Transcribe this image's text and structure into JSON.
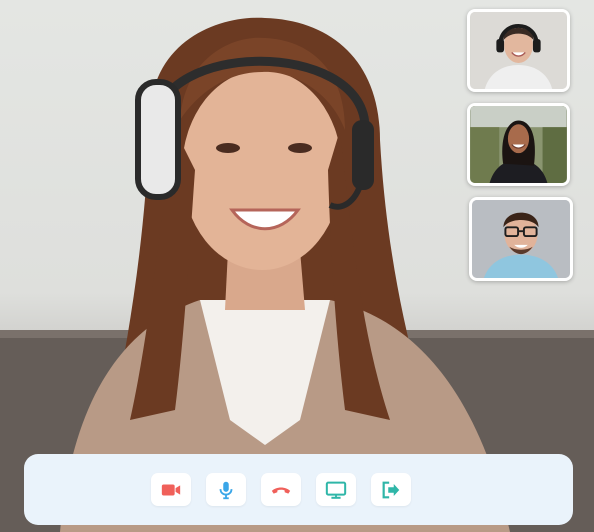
{
  "call": {
    "main_participant": {
      "description_icon": "person-headset-video"
    },
    "thumbnails": [
      {
        "icon": "participant-video",
        "accent": "#d9d7d2"
      },
      {
        "icon": "participant-video",
        "accent": "#7d8a6a"
      },
      {
        "icon": "participant-video",
        "accent": "#b9bdc2"
      }
    ]
  },
  "controls": [
    {
      "icon": "video-camera-icon",
      "color": "#f0605a"
    },
    {
      "icon": "microphone-icon",
      "color": "#3aa6e8"
    },
    {
      "icon": "hang-up-icon",
      "color": "#f0605a"
    },
    {
      "icon": "screen-share-icon",
      "color": "#2fb6a8"
    },
    {
      "icon": "leave-icon",
      "color": "#2fb6a8"
    }
  ],
  "colors": {
    "control_bar_bg": "#eaf3fb",
    "button_bg": "#ffffff",
    "thumbnail_border": "#ffffff"
  }
}
